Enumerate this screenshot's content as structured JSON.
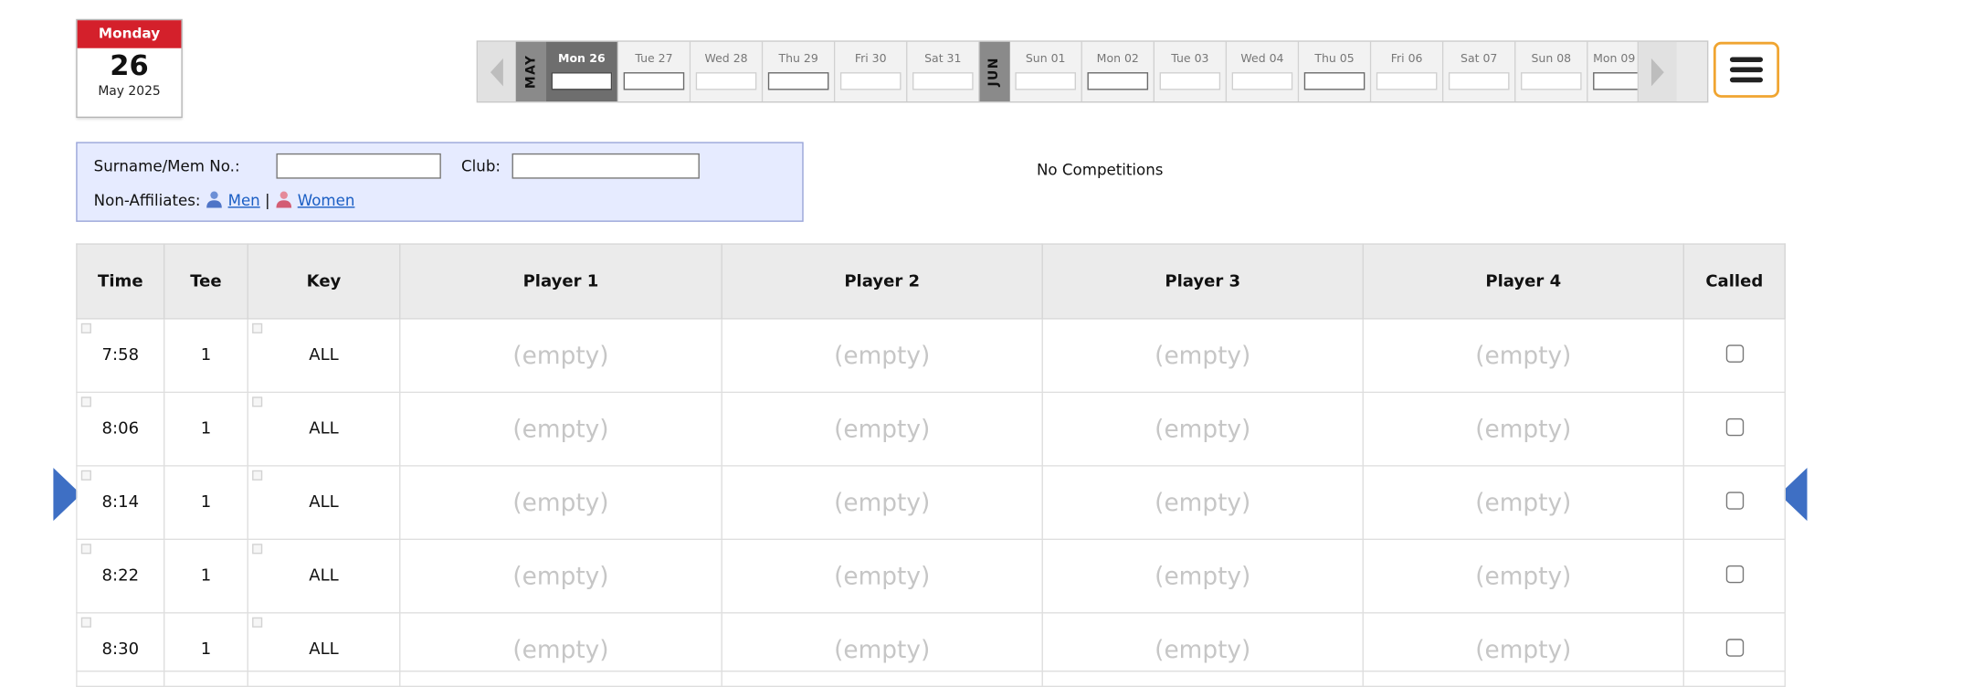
{
  "date_card": {
    "weekday": "Monday",
    "day": "26",
    "month_year": "May 2025"
  },
  "date_strip": {
    "prev_icon": "chevron-left-icon",
    "next_icon": "chevron-right-icon",
    "months": {
      "may": "MAY",
      "jun": "JUN"
    },
    "days": [
      {
        "label": "Mon 26",
        "selected": true
      },
      {
        "label": "Tue 27"
      },
      {
        "label": "Wed 28"
      },
      {
        "label": "Thu 29"
      },
      {
        "label": "Fri 30"
      },
      {
        "label": "Sat 31"
      },
      {
        "label": "Sun 01"
      },
      {
        "label": "Mon 02"
      },
      {
        "label": "Tue 03"
      },
      {
        "label": "Wed 04"
      },
      {
        "label": "Thu 05"
      },
      {
        "label": "Fri 06"
      },
      {
        "label": "Sat 07"
      },
      {
        "label": "Sun 08"
      },
      {
        "label": "Mon 09"
      }
    ]
  },
  "menu": {
    "icon": "hamburger-menu-icon"
  },
  "search": {
    "surname_label": "Surname/Mem No.:",
    "surname_value": "",
    "club_label": "Club:",
    "club_value": "",
    "non_affiliates_label": "Non-Affiliates:",
    "men_link": "Men",
    "separator": "|",
    "women_link": "Women"
  },
  "competitions_text": "No Competitions",
  "table": {
    "headers": [
      "Time",
      "Tee",
      "Key",
      "Player 1",
      "Player 2",
      "Player 3",
      "Player 4",
      "Called"
    ],
    "empty_text": "(empty)",
    "rows": [
      {
        "time": "7:58",
        "tee": "1",
        "key": "ALL",
        "called": false
      },
      {
        "time": "8:06",
        "tee": "1",
        "key": "ALL",
        "called": false
      },
      {
        "time": "8:14",
        "tee": "1",
        "key": "ALL",
        "called": false
      },
      {
        "time": "8:22",
        "tee": "1",
        "key": "ALL",
        "called": false
      },
      {
        "time": "8:30",
        "tee": "1",
        "key": "ALL",
        "called": false
      }
    ]
  },
  "colors": {
    "accent_red": "#d4202b",
    "menu_border": "#f0a531",
    "marker_blue": "#3e6fc4",
    "link_blue": "#1a5ec4",
    "panel_bg": "#e6ebff"
  }
}
